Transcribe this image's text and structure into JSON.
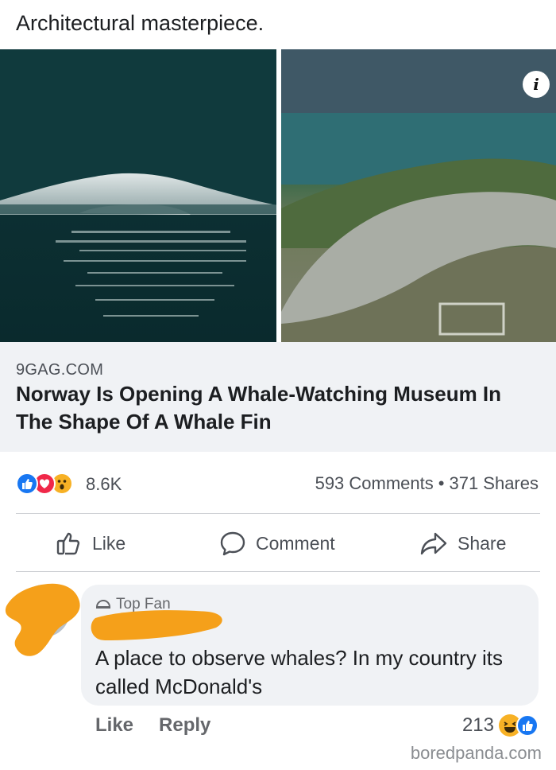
{
  "post": {
    "text": "Architectural masterpiece."
  },
  "link_preview": {
    "domain": "9GAG.COM",
    "headline": "Norway Is Opening A Whale-Watching Museum In The Shape Of A Whale Fin",
    "info_badge": "i"
  },
  "stats": {
    "reaction_icons": [
      "like-reaction-icon",
      "love-reaction-icon",
      "wow-reaction-icon"
    ],
    "reaction_count": "8.6K",
    "comments": "593 Comments",
    "separator": "•",
    "shares": "371 Shares"
  },
  "actions": {
    "like": "Like",
    "comment": "Comment",
    "share": "Share"
  },
  "comment": {
    "badge": "Top Fan",
    "text": "A place to observe whales? In my country its called McDonald's",
    "like": "Like",
    "reply": "Reply",
    "reaction_count": "213",
    "reaction_icons": [
      "haha-reaction-icon",
      "like-reaction-icon"
    ]
  },
  "watermark": "boredpanda.com",
  "colors": {
    "accent_blue": "#1877f2",
    "love_red": "#f02849",
    "wow_yellow": "#f7b125",
    "redaction_orange": "#f5a01a",
    "link_box_bg": "#f0f2f5"
  }
}
